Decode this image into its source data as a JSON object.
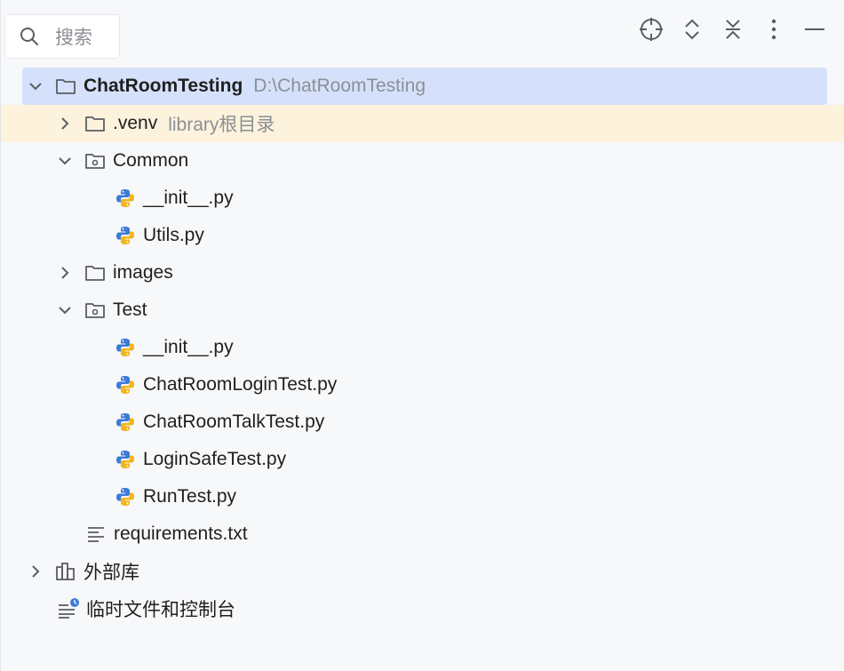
{
  "search": {
    "placeholder": "搜索"
  },
  "toolbar": {
    "icons": [
      "locate-icon",
      "expand-all-icon",
      "collapse-all-icon",
      "more-options-icon",
      "hide-panel-icon"
    ]
  },
  "tree": {
    "root": {
      "name": "ChatRoomTesting",
      "path": "D:\\ChatRoomTesting"
    },
    "venv": {
      "name": ".venv",
      "hint": "library根目录"
    },
    "common": {
      "name": "Common",
      "files": [
        "__init__.py",
        "Utils.py"
      ]
    },
    "images": {
      "name": "images"
    },
    "test": {
      "name": "Test",
      "files": [
        "__init__.py",
        "ChatRoomLoginTest.py",
        "ChatRoomTalkTest.py",
        "LoginSafeTest.py",
        "RunTest.py"
      ]
    },
    "requirements": {
      "name": "requirements.txt"
    },
    "external_libs": {
      "name": "外部库"
    },
    "scratches": {
      "name": "临时文件和控制台"
    }
  },
  "colors": {
    "selected_row": "#d5e1fb",
    "library_row": "#fdf3dd",
    "python_blue": "#3d7bd8",
    "python_yellow": "#f2b51b",
    "hint_text": "#8c8f96"
  }
}
